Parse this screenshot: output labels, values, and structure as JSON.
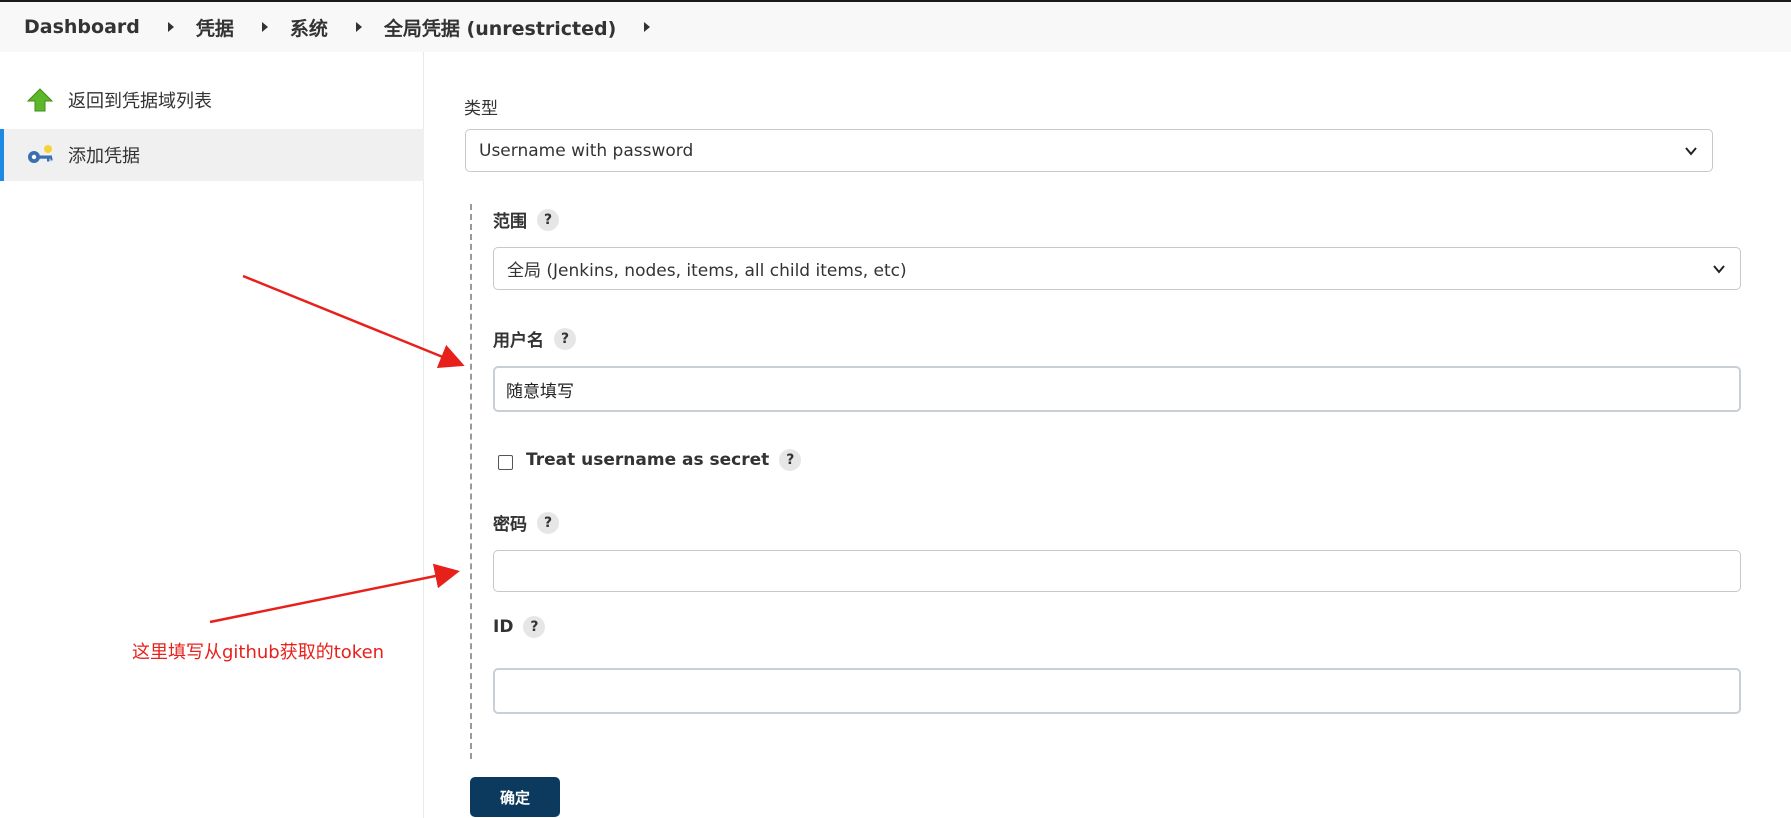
{
  "breadcrumb": {
    "items": [
      "Dashboard",
      "凭据",
      "系统",
      "全局凭据 (unrestricted)"
    ]
  },
  "sidebar": {
    "items": [
      {
        "label": "返回到凭据域列表",
        "icon": "up-arrow-icon"
      },
      {
        "label": "添加凭据",
        "icon": "key-icon"
      }
    ],
    "accent_color": "#1e88e5"
  },
  "form": {
    "kind": {
      "label": "类型",
      "value": "Username with password"
    },
    "scope": {
      "label": "范围",
      "value": "全局 (Jenkins, nodes, items, all child items, etc)",
      "help": "?"
    },
    "username": {
      "label": "用户名",
      "value": "随意填写",
      "help": "?"
    },
    "treat_secret": {
      "label": "Treat username as secret",
      "checked": false,
      "help": "?"
    },
    "password": {
      "label": "密码",
      "value": "",
      "help": "?"
    },
    "id": {
      "label": "ID",
      "value": "",
      "help": "?"
    },
    "submit_label": "确定",
    "submit_color": "#0b3a5e"
  },
  "annotation": {
    "text": "这里填写从github获取的token",
    "color": "#e8201c"
  }
}
